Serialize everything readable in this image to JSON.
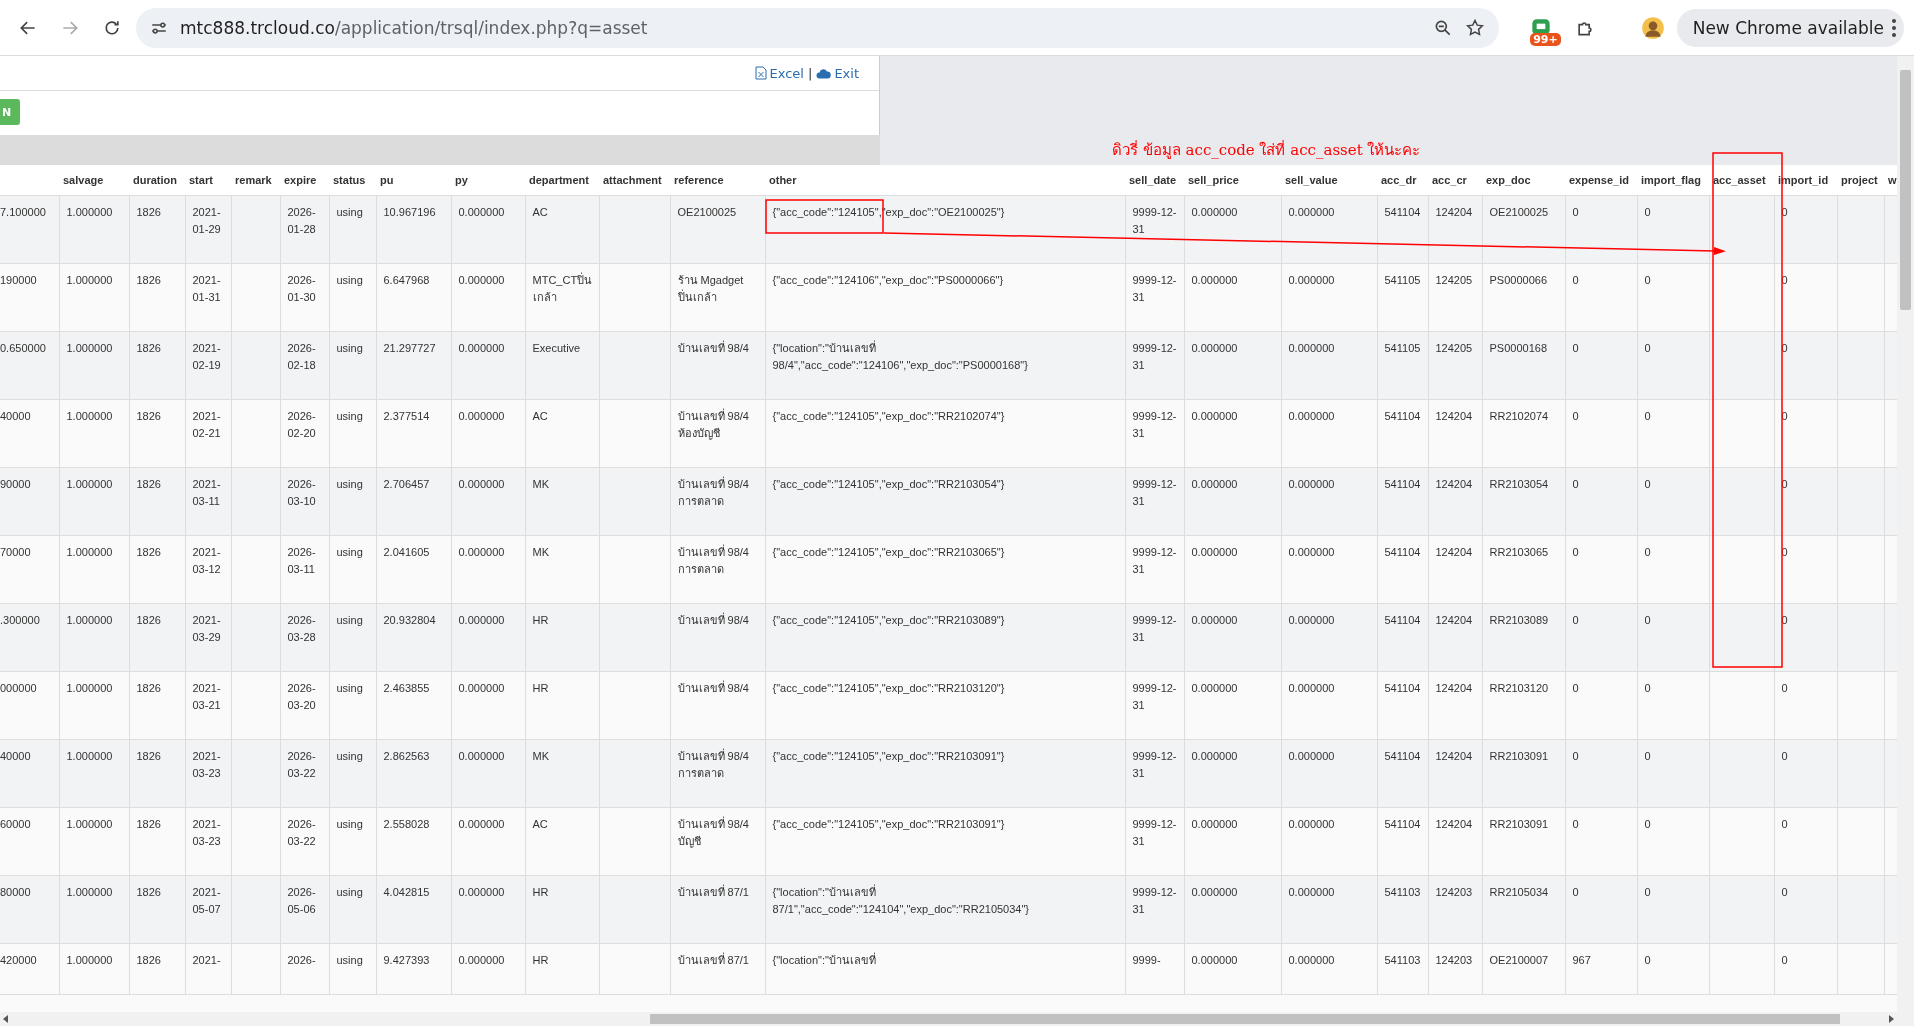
{
  "browser": {
    "url_domain": "mtc888.trcloud.co",
    "url_path": "/application/trsql/index.php?q=asset",
    "extension_badge": "99+",
    "update_button": "New Chrome available"
  },
  "toolbar": {
    "links": [
      {
        "kind": "excel",
        "label": "Excel"
      },
      {
        "kind": "exit",
        "label": "Exit"
      }
    ],
    "separator": "|",
    "button": "N"
  },
  "annotation": {
    "note": "ดิวรี่ ข้อมูล acc_code ใส่ที่ acc_asset ให้นะคะ"
  },
  "table": {
    "columns": [
      null,
      "salvage",
      "duration",
      "start",
      "remark",
      "expire",
      "status",
      "pu",
      "py",
      "department",
      "attachment",
      "reference",
      "other",
      "sell_date",
      "sell_price",
      "sell_value",
      "acc_dr",
      "acc_cr",
      "exp_doc",
      "expense_id",
      "import_flag",
      "acc_asset",
      "import_id",
      "project",
      "w"
    ],
    "rows": [
      [
        "7.100000",
        "1.000000",
        "1826",
        "2021-01-29",
        null,
        "2026-01-28",
        "using",
        "10.967196",
        "0.000000",
        "AC",
        null,
        "OE2100025",
        "{\"acc_code\":\"124105\",\"exp_doc\":\"OE2100025\"}",
        "9999-12-31",
        "0.000000",
        "0.000000",
        "541104",
        "124204",
        "OE2100025",
        "0",
        "0",
        null,
        "0",
        null,
        null
      ],
      [
        "190000",
        "1.000000",
        "1826",
        "2021-01-31",
        null,
        "2026-01-30",
        "using",
        "6.647968",
        "0.000000",
        "MTC_CTปิ่นเกล้า",
        null,
        "ร้าน Mgadget ปิ่นเกล้า",
        "{\"acc_code\":\"124106\",\"exp_doc\":\"PS0000066\"}",
        "9999-12-31",
        "0.000000",
        "0.000000",
        "541105",
        "124205",
        "PS0000066",
        "0",
        "0",
        null,
        "0",
        null,
        null
      ],
      [
        "0.650000",
        "1.000000",
        "1826",
        "2021-02-19",
        null,
        "2026-02-18",
        "using",
        "21.297727",
        "0.000000",
        "Executive",
        null,
        "บ้านเลขที่ 98/4",
        "{\"location\":\"บ้านเลขที่ 98/4\",\"acc_code\":\"124106\",\"exp_doc\":\"PS0000168\"}",
        "9999-12-31",
        "0.000000",
        "0.000000",
        "541105",
        "124205",
        "PS0000168",
        "0",
        "0",
        null,
        "0",
        null,
        null
      ],
      [
        "40000",
        "1.000000",
        "1826",
        "2021-02-21",
        null,
        "2026-02-20",
        "using",
        "2.377514",
        "0.000000",
        "AC",
        null,
        "บ้านเลขที่ 98/4 ห้องบัญชี",
        "{\"acc_code\":\"124105\",\"exp_doc\":\"RR2102074\"}",
        "9999-12-31",
        "0.000000",
        "0.000000",
        "541104",
        "124204",
        "RR2102074",
        "0",
        "0",
        null,
        "0",
        null,
        null
      ],
      [
        "90000",
        "1.000000",
        "1826",
        "2021-03-11",
        null,
        "2026-03-10",
        "using",
        "2.706457",
        "0.000000",
        "MK",
        null,
        "บ้านเลขที่ 98/4 การตลาด",
        "{\"acc_code\":\"124105\",\"exp_doc\":\"RR2103054\"}",
        "9999-12-31",
        "0.000000",
        "0.000000",
        "541104",
        "124204",
        "RR2103054",
        "0",
        "0",
        null,
        "0",
        null,
        null
      ],
      [
        "70000",
        "1.000000",
        "1826",
        "2021-03-12",
        null,
        "2026-03-11",
        "using",
        "2.041605",
        "0.000000",
        "MK",
        null,
        "บ้านเลขที่ 98/4 การตลาด",
        "{\"acc_code\":\"124105\",\"exp_doc\":\"RR2103065\"}",
        "9999-12-31",
        "0.000000",
        "0.000000",
        "541104",
        "124204",
        "RR2103065",
        "0",
        "0",
        null,
        "0",
        null,
        null
      ],
      [
        ".300000",
        "1.000000",
        "1826",
        "2021-03-29",
        null,
        "2026-03-28",
        "using",
        "20.932804",
        "0.000000",
        "HR",
        null,
        "บ้านเลขที่ 98/4",
        "{\"acc_code\":\"124105\",\"exp_doc\":\"RR2103089\"}",
        "9999-12-31",
        "0.000000",
        "0.000000",
        "541104",
        "124204",
        "RR2103089",
        "0",
        "0",
        null,
        "0",
        null,
        null
      ],
      [
        "000000",
        "1.000000",
        "1826",
        "2021-03-21",
        null,
        "2026-03-20",
        "using",
        "2.463855",
        "0.000000",
        "HR",
        null,
        "บ้านเลขที่ 98/4",
        "{\"acc_code\":\"124105\",\"exp_doc\":\"RR2103120\"}",
        "9999-12-31",
        "0.000000",
        "0.000000",
        "541104",
        "124204",
        "RR2103120",
        "0",
        "0",
        null,
        "0",
        null,
        null
      ],
      [
        "40000",
        "1.000000",
        "1826",
        "2021-03-23",
        null,
        "2026-03-22",
        "using",
        "2.862563",
        "0.000000",
        "MK",
        null,
        "บ้านเลขที่ 98/4 การตลาด",
        "{\"acc_code\":\"124105\",\"exp_doc\":\"RR2103091\"}",
        "9999-12-31",
        "0.000000",
        "0.000000",
        "541104",
        "124204",
        "RR2103091",
        "0",
        "0",
        null,
        "0",
        null,
        null
      ],
      [
        "60000",
        "1.000000",
        "1826",
        "2021-03-23",
        null,
        "2026-03-22",
        "using",
        "2.558028",
        "0.000000",
        "AC",
        null,
        "บ้านเลขที่ 98/4 บัญชี",
        "{\"acc_code\":\"124105\",\"exp_doc\":\"RR2103091\"}",
        "9999-12-31",
        "0.000000",
        "0.000000",
        "541104",
        "124204",
        "RR2103091",
        "0",
        "0",
        null,
        "0",
        null,
        null
      ],
      [
        "80000",
        "1.000000",
        "1826",
        "2021-05-07",
        null,
        "2026-05-06",
        "using",
        "4.042815",
        "0.000000",
        "HR",
        null,
        "บ้านเลขที่ 87/1",
        "{\"location\":\"บ้านเลขที่ 87/1\",\"acc_code\":\"124104\",\"exp_doc\":\"RR2105034\"}",
        "9999-12-31",
        "0.000000",
        "0.000000",
        "541103",
        "124203",
        "RR2105034",
        "0",
        "0",
        null,
        "0",
        null,
        null
      ],
      [
        "420000",
        "1.000000",
        "1826",
        "2021-",
        null,
        "2026-",
        "using",
        "9.427393",
        "0.000000",
        "HR",
        null,
        "บ้านเลขที่ 87/1",
        "{\"location\":\"บ้านเลขที่",
        "9999-",
        "0.000000",
        "0.000000",
        "541103",
        "124203",
        "OE2100007",
        "967",
        "0",
        null,
        "0",
        null,
        null
      ]
    ]
  }
}
